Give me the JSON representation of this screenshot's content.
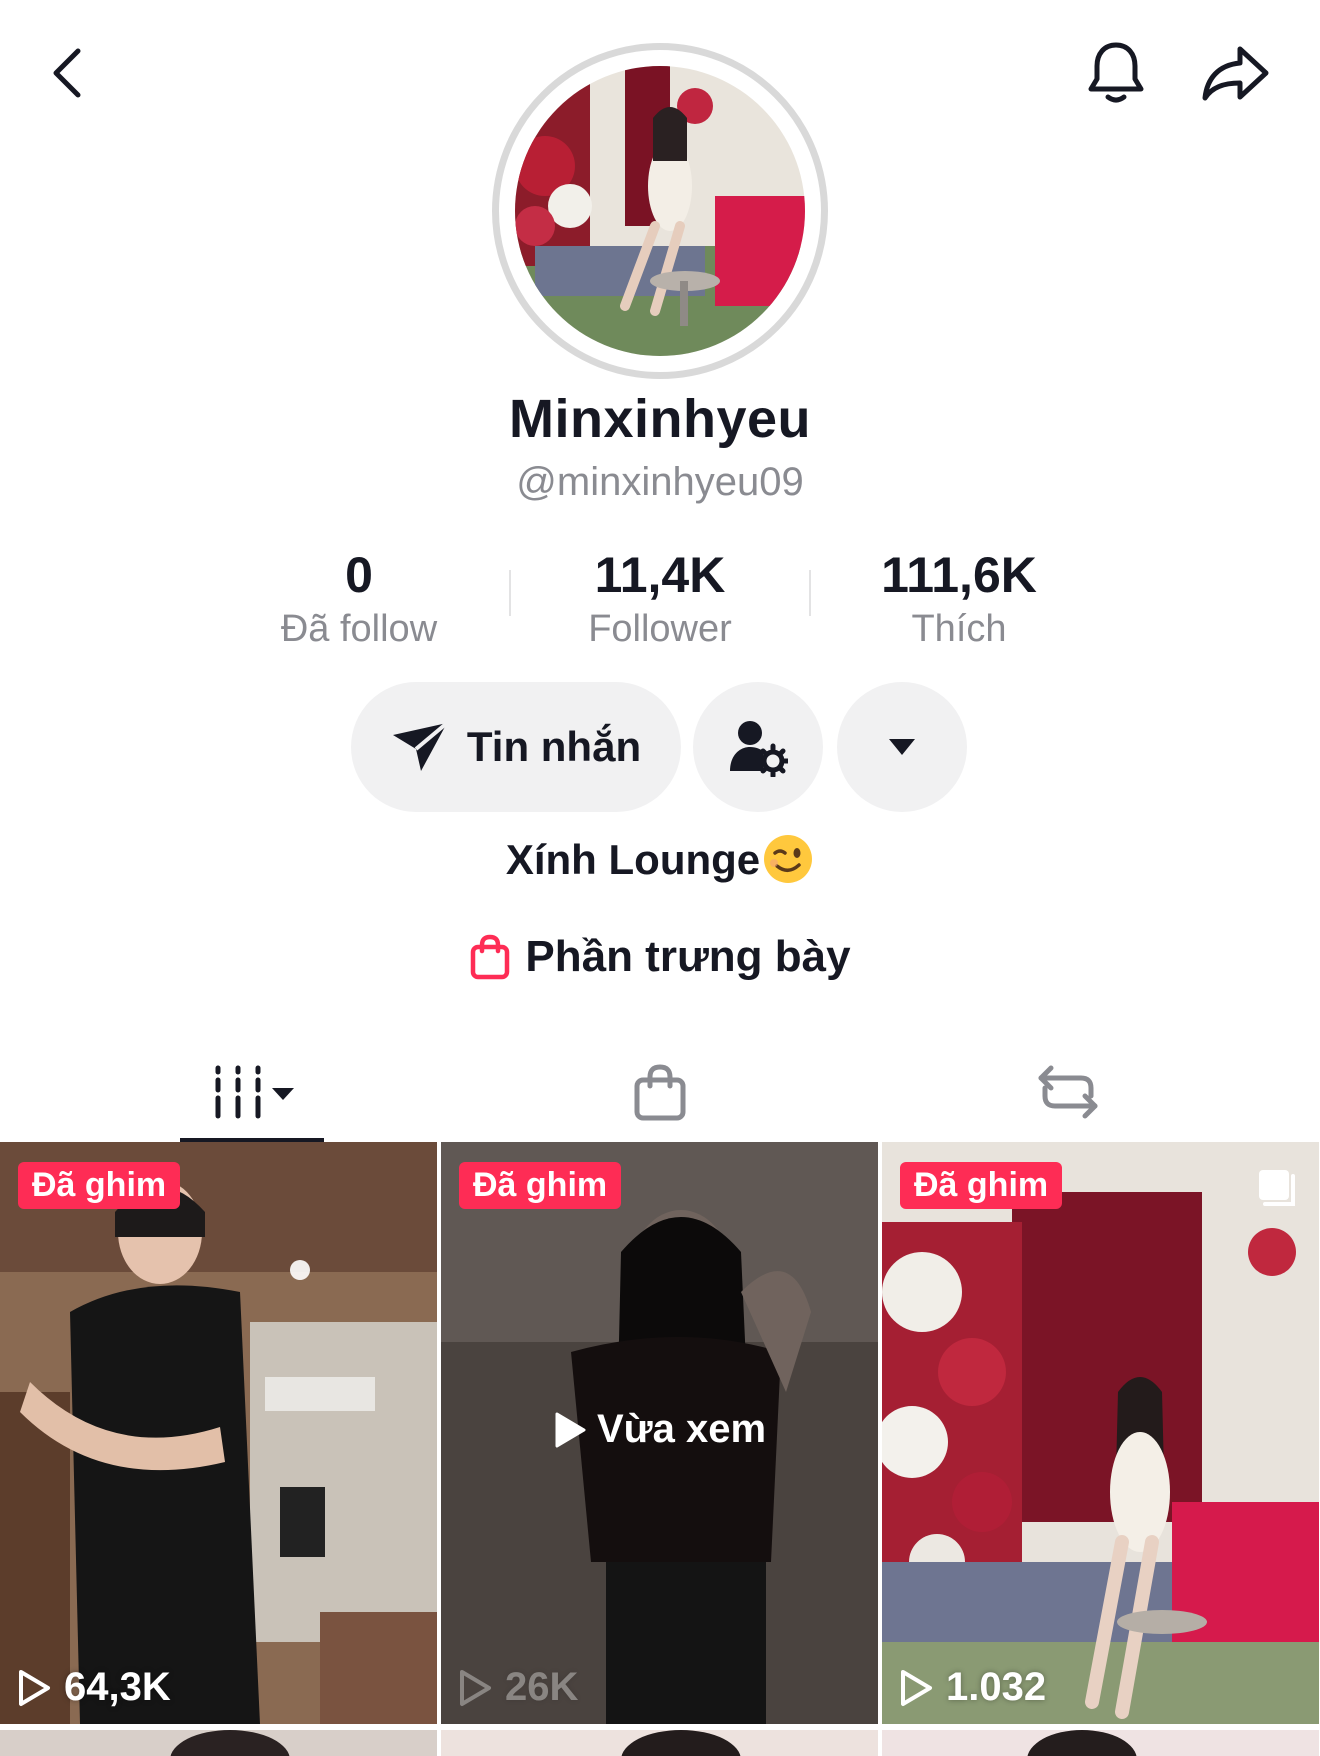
{
  "header": {
    "back_icon": "chevron-left-icon",
    "bell_icon": "bell-icon",
    "share_icon": "share-arrow-icon"
  },
  "profile": {
    "display_name": "Minxinhyeu",
    "handle": "@minxinhyeu09",
    "bio": "Xính Lounge",
    "bio_emoji": "winking-face-emoji"
  },
  "stats": [
    {
      "value": "0",
      "label": "Đã follow"
    },
    {
      "value": "11,4K",
      "label": "Follower"
    },
    {
      "value": "111,6K",
      "label": "Thích"
    }
  ],
  "actions": {
    "message_label": "Tin nhắn",
    "message_icon": "send-icon",
    "user_settings_icon": "user-gear-icon",
    "more_icon": "caret-down-icon"
  },
  "showcase": {
    "label": "Phần trưng bày",
    "icon": "shopping-bag-icon",
    "icon_color": "#fe2c55"
  },
  "tabs": [
    {
      "name": "videos",
      "icon": "grid-videos-icon",
      "active": true
    },
    {
      "name": "shop",
      "icon": "shopping-bag-icon",
      "active": false
    },
    {
      "name": "repost",
      "icon": "repost-icon",
      "active": false
    }
  ],
  "videos": [
    {
      "badge": "Đã ghim",
      "views": "64,3K",
      "watched": false
    },
    {
      "badge": "Đã ghim",
      "views": "26K",
      "watched": true,
      "watched_label": "Vừa xem"
    },
    {
      "badge": "Đã ghim",
      "views": "1.032",
      "watched": false,
      "multi": true
    }
  ],
  "colors": {
    "accent": "#fe2c55",
    "text": "#161823",
    "secondary": "#8a8b91",
    "button_bg": "#f1f1f2"
  }
}
